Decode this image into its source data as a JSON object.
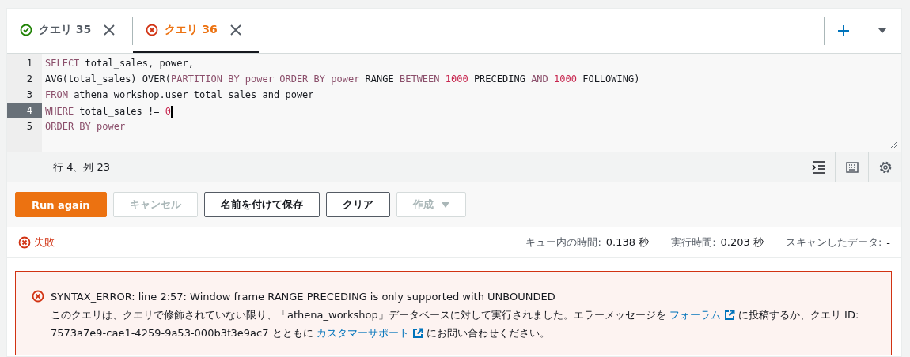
{
  "tabs": [
    {
      "label": "クエリ 35",
      "kind": "success",
      "selected": false
    },
    {
      "label": "クエリ 36",
      "kind": "error",
      "selected": true
    }
  ],
  "editor": {
    "lines": [
      {
        "number": "1",
        "current": false,
        "tokens": [
          {
            "kind": "kw",
            "text": "SELECT"
          },
          {
            "kind": "id",
            "text": " total_sales, power,"
          }
        ]
      },
      {
        "number": "2",
        "current": false,
        "tokens": [
          {
            "kind": "id",
            "text": "AVG(total_sales) OVER("
          },
          {
            "kind": "kw",
            "text": "PARTITION BY power ORDER BY power "
          },
          {
            "kind": "id",
            "text": "RANGE "
          },
          {
            "kind": "kw",
            "text": "BETWEEN "
          },
          {
            "kind": "num",
            "text": "1000"
          },
          {
            "kind": "id",
            "text": " PRECEDING "
          },
          {
            "kind": "kw",
            "text": "AND "
          },
          {
            "kind": "num",
            "text": "1000"
          },
          {
            "kind": "id",
            "text": " FOLLOWING)"
          }
        ]
      },
      {
        "number": "3",
        "current": false,
        "tokens": [
          {
            "kind": "kw",
            "text": "FROM"
          },
          {
            "kind": "id",
            "text": " athena_workshop.user_total_sales_and_power"
          }
        ]
      },
      {
        "number": "4",
        "current": true,
        "tokens": [
          {
            "kind": "kw",
            "text": "WHERE"
          },
          {
            "kind": "id",
            "text": " total_sales != "
          },
          {
            "kind": "num",
            "text": "0"
          }
        ]
      },
      {
        "number": "5",
        "current": false,
        "tokens": [
          {
            "kind": "kw",
            "text": "ORDER BY power"
          }
        ]
      }
    ]
  },
  "cursor_position": "行 4、列 23",
  "buttons": [
    {
      "label": "Run again",
      "kind": "primary",
      "disabled": false
    },
    {
      "label": "キャンセル",
      "kind": "normal",
      "disabled": true
    },
    {
      "label": "名前を付けて保存",
      "kind": "normal",
      "disabled": false
    },
    {
      "label": "クリア",
      "kind": "normal",
      "disabled": false
    },
    {
      "label": "作成",
      "kind": "dropdown",
      "disabled": true
    }
  ],
  "status": {
    "text": "失敗",
    "stats": [
      {
        "label": "キュー内の時間:",
        "value": "0.138 秒"
      },
      {
        "label": "実行時間:",
        "value": "0.203 秒"
      },
      {
        "label": "スキャンしたデータ:",
        "value": "-"
      }
    ]
  },
  "error": {
    "title": "SYNTAX_ERROR: line 2:57: Window frame RANGE PRECEDING is only supported with UNBOUNDED",
    "message": [
      {
        "kind": "text",
        "text": "このクエリは、クエリで修飾されていない限り、「athena_workshop」データベースに対して実行されました。エラーメッセージを "
      },
      {
        "kind": "link",
        "text": "フォーラム"
      },
      {
        "kind": "text",
        "text": " に投稿するか、クエリ ID: 7573a7e9-cae1-4259-9a53-000b3f3e9ac7 とともに "
      },
      {
        "kind": "link",
        "text": "カスタマーサポート"
      },
      {
        "kind": "text",
        "text": " にお問い合わせください。"
      }
    ]
  }
}
